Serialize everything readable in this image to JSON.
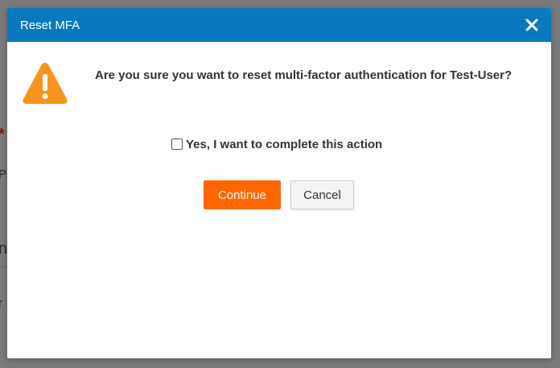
{
  "background": {
    "fragments": {
      "required_marker": "*",
      "line1": "P",
      "line2": "n",
      "line3": "r"
    }
  },
  "dialog": {
    "title": "Reset MFA",
    "close_icon": "close-icon",
    "warning_icon": "warning-triangle-icon",
    "message": "Are you sure you want to reset multi-factor authentication for Test-User?",
    "confirm_checkbox": {
      "label": "Yes, I want to complete this action",
      "checked": false
    },
    "buttons": {
      "continue_label": "Continue",
      "cancel_label": "Cancel"
    }
  },
  "colors": {
    "header": "#0a78be",
    "primary_button": "#ff6600",
    "warning": "#f7941d"
  }
}
